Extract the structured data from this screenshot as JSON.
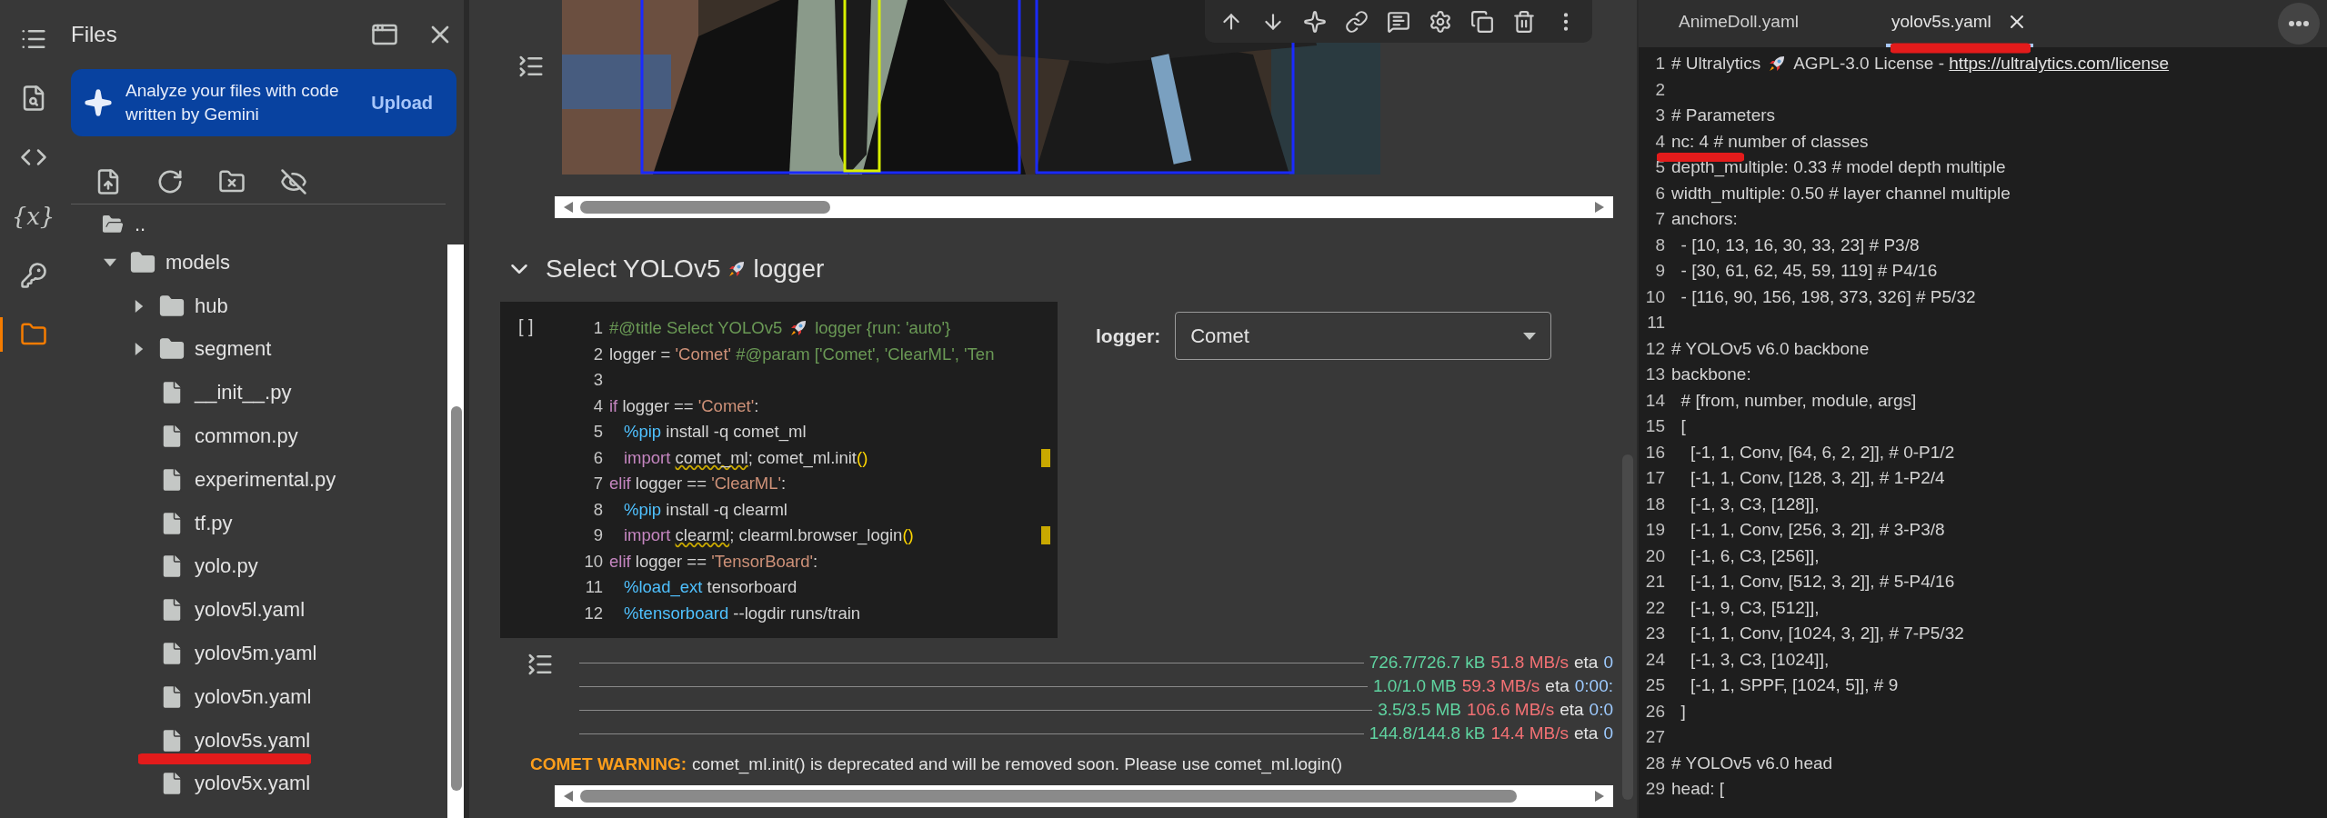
{
  "activity_bar": [
    {
      "selected": false
    },
    {
      "selected": false
    },
    {
      "selected": false
    },
    {
      "glyph": "{x}",
      "selected": false
    },
    {
      "selected": false
    },
    {
      "selected": true
    }
  ],
  "files_panel": {
    "title": "Files",
    "banner": {
      "text": "Analyze your files with code written by Gemini",
      "action": "Upload"
    },
    "tree": [
      {
        "name": "..",
        "kind": "parent"
      },
      {
        "name": "models",
        "kind": "folder",
        "expanded": true,
        "children": [
          {
            "name": "hub",
            "kind": "folder",
            "expanded": false
          },
          {
            "name": "segment",
            "kind": "folder",
            "expanded": false
          },
          {
            "name": "__init__.py",
            "kind": "file"
          },
          {
            "name": "common.py",
            "kind": "file"
          },
          {
            "name": "experimental.py",
            "kind": "file"
          },
          {
            "name": "tf.py",
            "kind": "file"
          },
          {
            "name": "yolo.py",
            "kind": "file"
          },
          {
            "name": "yolov5l.yaml",
            "kind": "file"
          },
          {
            "name": "yolov5m.yaml",
            "kind": "file"
          },
          {
            "name": "yolov5n.yaml",
            "kind": "file"
          },
          {
            "name": "yolov5s.yaml",
            "kind": "file"
          },
          {
            "name": "yolov5x.yaml",
            "kind": "file"
          }
        ]
      }
    ]
  },
  "notebook": {
    "section": {
      "title_start": "Select YOLOv5",
      "title_end": "logger",
      "expanded": true
    },
    "code_cell": {
      "run_label": "[ ]",
      "lines": [
        {
          "no": "1",
          "indented": false,
          "flagged": false,
          "tokens": [
            {
              "kind": "comment",
              "text": "#@title Select YOLOv5"
            },
            {
              "kind": "rocket"
            },
            {
              "kind": "comment",
              "text": "logger {run: 'auto'}"
            }
          ]
        },
        {
          "no": "2",
          "indented": false,
          "flagged": false,
          "tokens": [
            {
              "kind": "plain",
              "text": "logger = "
            },
            {
              "kind": "string",
              "text": "'Comet'"
            },
            {
              "kind": "comment",
              "text": " #@param ['Comet', 'ClearML', 'Ten"
            }
          ]
        },
        {
          "no": "3",
          "flagged": false
        },
        {
          "no": "4",
          "indented": false,
          "flagged": false,
          "tokens": [
            {
              "kind": "keyword",
              "text": "if "
            },
            {
              "kind": "plain",
              "text": "logger == "
            },
            {
              "kind": "string",
              "text": "'Comet'"
            },
            {
              "kind": "plain",
              "text": ":"
            }
          ]
        },
        {
          "no": "5",
          "indented": true,
          "flagged": false,
          "tokens": [
            {
              "kind": "magic",
              "text": "%pip"
            },
            {
              "kind": "plain",
              "text": " install -q comet_ml"
            }
          ]
        },
        {
          "no": "6",
          "indented": true,
          "flagged": true,
          "tokens": [
            {
              "kind": "keyword",
              "text": "import "
            },
            {
              "kind": "squiggle",
              "text": "comet_ml"
            },
            {
              "kind": "plain",
              "text": "; comet_ml.init"
            },
            {
              "kind": "paren",
              "text": "()"
            }
          ]
        },
        {
          "no": "7",
          "indented": false,
          "flagged": false,
          "tokens": [
            {
              "kind": "keyword",
              "text": "elif "
            },
            {
              "kind": "plain",
              "text": "logger == "
            },
            {
              "kind": "string",
              "text": "'ClearML'"
            },
            {
              "kind": "plain",
              "text": ":"
            }
          ]
        },
        {
          "no": "8",
          "indented": true,
          "flagged": false,
          "tokens": [
            {
              "kind": "magic",
              "text": "%pip"
            },
            {
              "kind": "plain",
              "text": " install -q clearml"
            }
          ]
        },
        {
          "no": "9",
          "indented": true,
          "flagged": true,
          "tokens": [
            {
              "kind": "keyword",
              "text": "import "
            },
            {
              "kind": "squiggle",
              "text": "clearml"
            },
            {
              "kind": "plain",
              "text": "; clearml.browser_login"
            },
            {
              "kind": "paren",
              "text": "()"
            }
          ]
        },
        {
          "no": "10",
          "indented": false,
          "flagged": false,
          "tokens": [
            {
              "kind": "keyword",
              "text": "elif "
            },
            {
              "kind": "plain",
              "text": "logger == "
            },
            {
              "kind": "string",
              "text": "'TensorBoard'"
            },
            {
              "kind": "plain",
              "text": ":"
            }
          ]
        },
        {
          "no": "11",
          "indented": true,
          "flagged": false,
          "tokens": [
            {
              "kind": "magic",
              "text": "%load_ext"
            },
            {
              "kind": "plain",
              "text": " tensorboard"
            }
          ]
        },
        {
          "no": "12",
          "indented": true,
          "flagged": false,
          "tokens": [
            {
              "kind": "magic",
              "text": "%tensorboard"
            },
            {
              "kind": "plain",
              "text": " --logdir runs/train"
            }
          ]
        }
      ]
    },
    "form": {
      "label": "logger:",
      "value": "Comet"
    },
    "output": {
      "progress": [
        {
          "size": "726.7/726.7 kB",
          "speed": "51.8 MB/s",
          "eta": "eta",
          "eta_value": "0"
        },
        {
          "size": "1.0/1.0 MB",
          "speed": "59.3 MB/s",
          "eta": "eta",
          "eta_value": "0:00:"
        },
        {
          "size": "3.5/3.5 MB",
          "speed": "106.6 MB/s",
          "eta": "eta",
          "eta_value": "0:0"
        },
        {
          "size": "144.8/144.8 kB",
          "speed": "14.4 MB/s",
          "eta": "eta",
          "eta_value": "0"
        }
      ],
      "warning": {
        "label": "COMET WARNING:",
        "text": "comet_ml.init() is deprecated and will be removed soon. Please use comet_ml.login()"
      }
    }
  },
  "editor": {
    "tabs": [
      {
        "label": "AnimeDoll.yaml",
        "selected": false
      },
      {
        "label": "yolov5s.yaml",
        "selected": true
      }
    ],
    "lines": [
      {
        "no": "1",
        "tokens": [
          {
            "kind": "plain",
            "text": "# Ultralytics"
          },
          {
            "kind": "rocket"
          },
          {
            "kind": "plain",
            "text": "AGPL-3.0 License - "
          },
          {
            "kind": "link",
            "text": "https://ultralytics.com/license"
          }
        ]
      },
      {
        "no": "2"
      },
      {
        "no": "3",
        "tokens": [
          {
            "kind": "plain",
            "text": "# Parameters"
          }
        ]
      },
      {
        "no": "4",
        "tokens": [
          {
            "kind": "plain",
            "text": "nc: 4 # number of classes"
          }
        ]
      },
      {
        "no": "5",
        "tokens": [
          {
            "kind": "plain",
            "text": "depth_multiple: 0.33 # model depth multiple"
          }
        ]
      },
      {
        "no": "6",
        "tokens": [
          {
            "kind": "plain",
            "text": "width_multiple: 0.50 # layer channel multiple"
          }
        ]
      },
      {
        "no": "7",
        "tokens": [
          {
            "kind": "plain",
            "text": "anchors:"
          }
        ]
      },
      {
        "no": "8",
        "tokens": [
          {
            "kind": "plain",
            "text": "  - [10, 13, 16, 30, 33, 23] # P3/8"
          }
        ]
      },
      {
        "no": "9",
        "tokens": [
          {
            "kind": "plain",
            "text": "  - [30, 61, 62, 45, 59, 119] # P4/16"
          }
        ]
      },
      {
        "no": "10",
        "tokens": [
          {
            "kind": "plain",
            "text": "  - [116, 90, 156, 198, 373, 326] # P5/32"
          }
        ]
      },
      {
        "no": "11"
      },
      {
        "no": "12",
        "tokens": [
          {
            "kind": "plain",
            "text": "# YOLOv5 v6.0 backbone"
          }
        ]
      },
      {
        "no": "13",
        "tokens": [
          {
            "kind": "plain",
            "text": "backbone:"
          }
        ]
      },
      {
        "no": "14",
        "tokens": [
          {
            "kind": "plain",
            "text": "  # [from, number, module, args]"
          }
        ]
      },
      {
        "no": "15",
        "tokens": [
          {
            "kind": "plain",
            "text": "  ["
          }
        ]
      },
      {
        "no": "16",
        "tokens": [
          {
            "kind": "plain",
            "text": "    [-1, 1, Conv, [64, 6, 2, 2]], # 0-P1/2"
          }
        ]
      },
      {
        "no": "17",
        "tokens": [
          {
            "kind": "plain",
            "text": "    [-1, 1, Conv, [128, 3, 2]], # 1-P2/4"
          }
        ]
      },
      {
        "no": "18",
        "tokens": [
          {
            "kind": "plain",
            "text": "    [-1, 3, C3, [128]],"
          }
        ]
      },
      {
        "no": "19",
        "tokens": [
          {
            "kind": "plain",
            "text": "    [-1, 1, Conv, [256, 3, 2]], # 3-P3/8"
          }
        ]
      },
      {
        "no": "20",
        "tokens": [
          {
            "kind": "plain",
            "text": "    [-1, 6, C3, [256]],"
          }
        ]
      },
      {
        "no": "21",
        "tokens": [
          {
            "kind": "plain",
            "text": "    [-1, 1, Conv, [512, 3, 2]], # 5-P4/16"
          }
        ]
      },
      {
        "no": "22",
        "tokens": [
          {
            "kind": "plain",
            "text": "    [-1, 9, C3, [512]],"
          }
        ]
      },
      {
        "no": "23",
        "tokens": [
          {
            "kind": "plain",
            "text": "    [-1, 1, Conv, [1024, 3, 2]], # 7-P5/32"
          }
        ]
      },
      {
        "no": "24",
        "tokens": [
          {
            "kind": "plain",
            "text": "    [-1, 3, C3, [1024]],"
          }
        ]
      },
      {
        "no": "25",
        "tokens": [
          {
            "kind": "plain",
            "text": "    [-1, 1, SPPF, [1024, 5]], # 9"
          }
        ]
      },
      {
        "no": "26",
        "tokens": [
          {
            "kind": "plain",
            "text": "  ]"
          }
        ]
      },
      {
        "no": "27"
      },
      {
        "no": "28",
        "tokens": [
          {
            "kind": "plain",
            "text": "# YOLOv5 v6.0 head"
          }
        ]
      },
      {
        "no": "29",
        "tokens": [
          {
            "kind": "plain",
            "text": "head: ["
          }
        ]
      }
    ]
  }
}
